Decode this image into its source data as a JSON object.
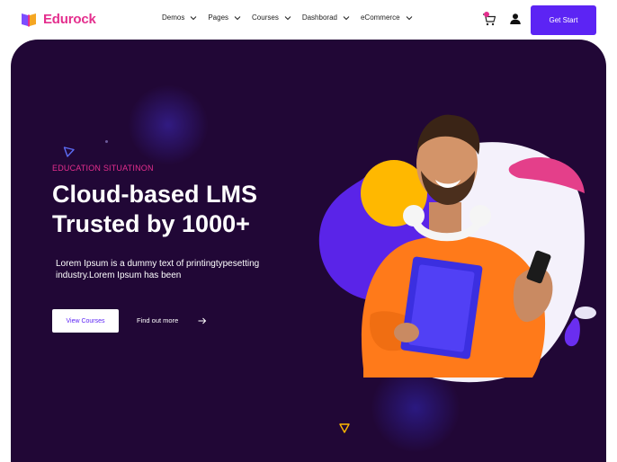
{
  "brand": {
    "name": "Edurock",
    "color": "#e42e8d",
    "icon": "book-logo-icon"
  },
  "nav": {
    "items": [
      {
        "label": "Demos"
      },
      {
        "label": "Pages"
      },
      {
        "label": "Courses"
      },
      {
        "label": "Dashborad"
      },
      {
        "label": "eCommerce"
      }
    ],
    "cart_icon": "cart-icon",
    "user_icon": "user-icon",
    "cta_label": "Get Start",
    "accent": "#5c24f4"
  },
  "hero": {
    "eyebrow": "EDUCATION SITUATINON",
    "headline_line1": "Cloud-based LMS",
    "headline_line2": "Trusted by 1000+",
    "subtext_line1": "Lorem Ipsum is a dummy text of printingtypesetting",
    "subtext_line2": "industry.Lorem Ipsum has been",
    "primary_button": "View Courses",
    "secondary_link": "Find out more",
    "background": "#210736"
  }
}
